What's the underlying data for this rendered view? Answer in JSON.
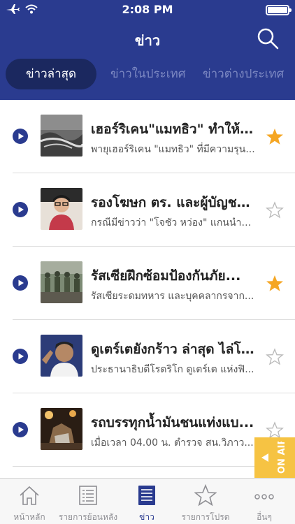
{
  "status": {
    "time": "2:08 PM"
  },
  "header": {
    "title": "ข่าว"
  },
  "tabs": [
    {
      "label": "ข่าวล่าสุด",
      "active": true
    },
    {
      "label": "ข่าวในประเทศ",
      "active": false
    },
    {
      "label": "ข่าวต่างประเทศ",
      "active": false
    }
  ],
  "news": [
    {
      "title": "เฮอร์ริเคน\"แมทธิว\" ทำให้มี...",
      "desc": "พายุเฮอร์ริเคน \"แมทธิว\" ที่มีความรุน...",
      "starred": true
    },
    {
      "title": "รองโฆษก ตร. และผู้บัญชา...",
      "desc": "กรณีมีข่าวว่า \"โจชัว หว่อง\" แกนนำนั...",
      "starred": false
    },
    {
      "title": "รัสเซียฝึกซ้อมป้องกันภัย...",
      "desc": "รัสเซียระดมทหาร และบุคคลากรจาก...",
      "starred": true
    },
    {
      "title": "ดูเตร์เตยังกร้าว ล่าสุด ไล่โ...",
      "desc": "ประธานาธิบดีโรดริโก ดูเตร์เต แห่งฟิ...",
      "starred": false
    },
    {
      "title": "รถบรรทุกน้ำมันชนแท่งแบ...",
      "desc": "เมื่อเวลา 04.00 น. ตำรวจ สน.วิภาว...",
      "starred": false
    }
  ],
  "onair": {
    "label": "ON AIR"
  },
  "tabbar": [
    {
      "label": "หน้าหลัก",
      "icon": "home-icon"
    },
    {
      "label": "รายการย้อนหลัง",
      "icon": "list-icon"
    },
    {
      "label": "ข่าว",
      "icon": "news-icon",
      "active": true
    },
    {
      "label": "รายการโปรด",
      "icon": "star-icon"
    },
    {
      "label": "อื่นๆ",
      "icon": "more-icon"
    }
  ],
  "colors": {
    "primary": "#2a3b8f",
    "tab_active_bg": "#1b285f",
    "star": "#f5a623",
    "onair": "#f6c343"
  }
}
